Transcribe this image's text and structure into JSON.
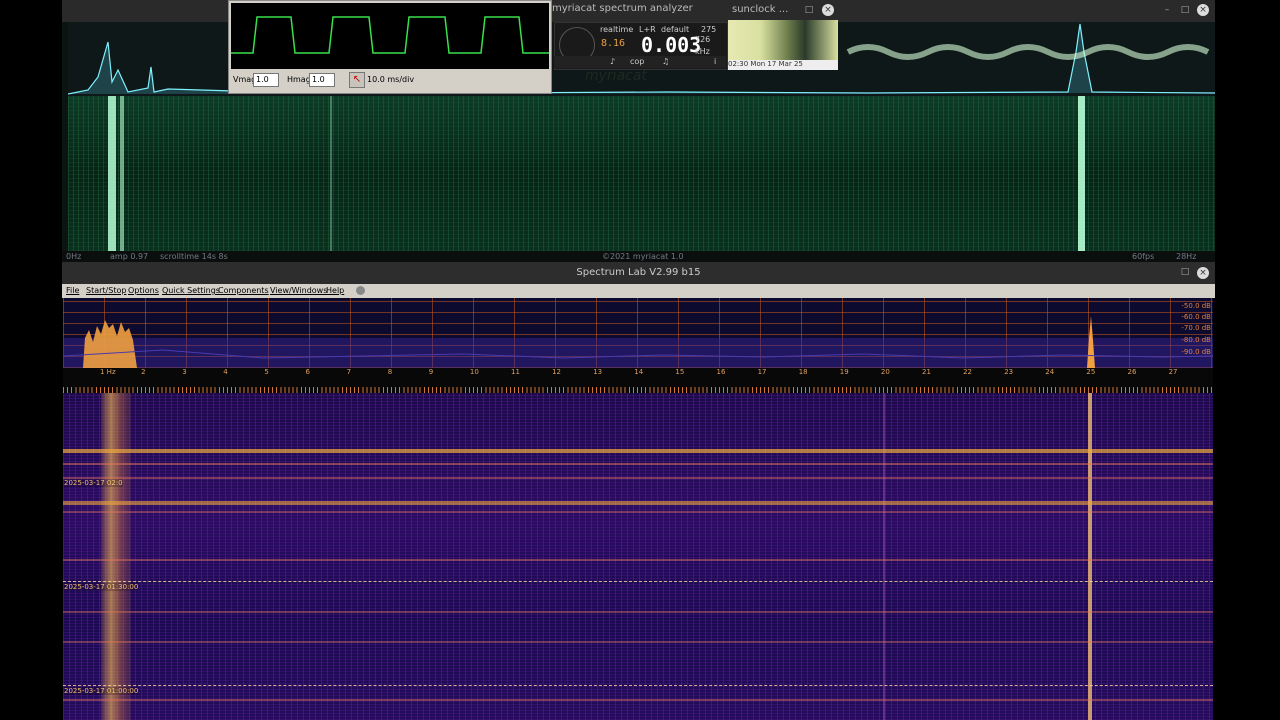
{
  "myriacat": {
    "title": "myriacat spectrum analyzer",
    "status": {
      "left": "0Hz",
      "amp": "amp 0.97",
      "scroll": "scrolltime 14s 8s",
      "center": "©2021 myriacat 1.0",
      "fps": "60fps",
      "right": "28Hz"
    },
    "oscilloscope": {
      "vmag_label": "Vmag",
      "vmag_value": "1.0",
      "hmag_label": "Hmag",
      "hmag_value": "1.0",
      "timebase": "10.0 ms/div"
    },
    "readout": {
      "mode": "realtime",
      "channel": "L+R",
      "preset": "default",
      "count": "275",
      "value": "0.003",
      "small_value": "726",
      "unit": "kHz",
      "mini_display": "8.16",
      "btn_cop": "cop",
      "logo": "myriacat"
    }
  },
  "sunclock": {
    "title": "sunclock ...",
    "time": "02:30 Mon 17 Mar 25"
  },
  "spectrumlab": {
    "title": "Spectrum Lab V2.99 b15",
    "menu": [
      "File",
      "Start/Stop",
      "Options",
      "Quick Settings",
      "Components",
      "View/Windows",
      "Help"
    ],
    "freq_labels": [
      "1 Hz",
      "2",
      "3",
      "4",
      "5",
      "6",
      "7",
      "8",
      "9",
      "10",
      "11",
      "12",
      "13",
      "14",
      "15",
      "16",
      "17",
      "18",
      "19",
      "20",
      "21",
      "22",
      "23",
      "24",
      "25",
      "26",
      "27"
    ],
    "db_labels": [
      "-50.0 dB",
      "-60.0 dB",
      "-70.0 dB",
      "-80.0 dB",
      "-90.0 dB"
    ],
    "timestamps": [
      "2025-03-17 02:0",
      "2025-03-17 01:30:00",
      "2025-03-17 01:00:00"
    ]
  },
  "colors": {
    "green_trace": "#39e04a",
    "spectrum_orange": "#f0a040",
    "waterfall_purple": "#2a0c60",
    "cyan_peak": "#7ff0ff"
  }
}
